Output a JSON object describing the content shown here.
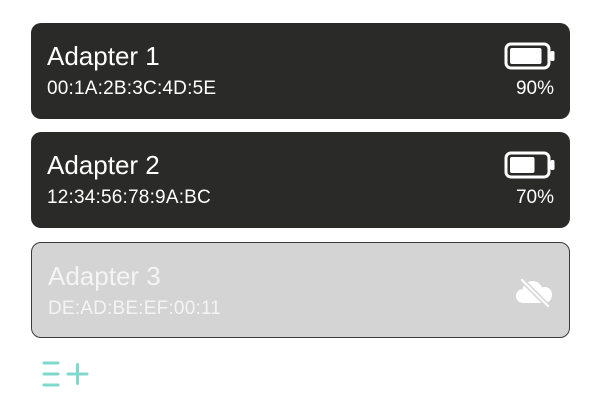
{
  "adapters": [
    {
      "name": "Adapter 1",
      "mac": "00:1A:2B:3C:4D:5E",
      "battery_percent_text": "90%",
      "battery_level": 0.9,
      "status": "connected",
      "icon": "battery-icon"
    },
    {
      "name": "Adapter 2",
      "mac": "12:34:56:78:9A:BC",
      "battery_percent_text": "70%",
      "battery_level": 0.7,
      "status": "connected",
      "icon": "battery-icon"
    },
    {
      "name": "Adapter 3",
      "mac": "DE:AD:BE:EF:00:11",
      "status": "disconnected",
      "icon": "cloud-offline-icon"
    }
  ],
  "toolbar": {
    "add_icon": "add-list-icon"
  },
  "colors": {
    "card_online_bg": "#2a2a28",
    "card_offline_bg": "#d4d4d4",
    "card_offline_text": "#f4f4f4",
    "accent": "#7fd8cc"
  }
}
